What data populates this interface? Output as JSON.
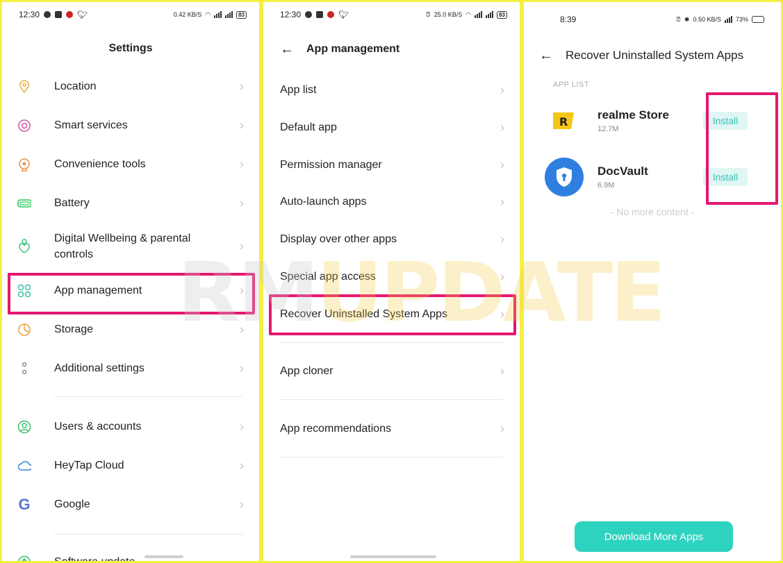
{
  "panel1": {
    "status": {
      "time": "12:30",
      "net": "0.42 KB/S",
      "battery": "83"
    },
    "title": "Settings",
    "items": [
      {
        "label": "Location",
        "icon": "location-pin-icon",
        "color": "#e9b44c"
      },
      {
        "label": "Smart services",
        "icon": "smart-services-icon",
        "color": "#d257a5"
      },
      {
        "label": "Convenience tools",
        "icon": "convenience-tools-icon",
        "color": "#e9964c"
      },
      {
        "label": "Battery",
        "icon": "battery-icon",
        "color": "#2ec45f"
      },
      {
        "label": "Digital Wellbeing & parental controls",
        "icon": "wellbeing-heart-icon",
        "color": "#3bbf7a"
      },
      {
        "label": "App management",
        "icon": "app-management-icon",
        "color": "#36c0a8"
      },
      {
        "label": "Storage",
        "icon": "storage-pie-icon",
        "color": "#f0a23b"
      },
      {
        "label": "Additional settings",
        "icon": "additional-settings-icon",
        "color": "#888888"
      },
      {
        "label": "Users & accounts",
        "icon": "users-accounts-icon",
        "color": "#3bbf6c"
      },
      {
        "label": "HeyTap Cloud",
        "icon": "cloud-icon",
        "color": "#3b82d8"
      },
      {
        "label": "Google",
        "icon": "google-g-icon",
        "color": "#5b73c9"
      },
      {
        "label": "Software update",
        "icon": "software-update-icon",
        "color": "#3bbf6c"
      }
    ]
  },
  "panel2": {
    "status": {
      "time": "12:30",
      "net": "25.0 KB/S",
      "battery": "83"
    },
    "title": "App management",
    "items": [
      {
        "label": "App list"
      },
      {
        "label": "Default app"
      },
      {
        "label": "Permission manager"
      },
      {
        "label": "Auto-launch apps"
      },
      {
        "label": "Display over other apps"
      },
      {
        "label": "Special app access"
      },
      {
        "label": "Recover Uninstalled System Apps"
      },
      {
        "label": "App cloner"
      },
      {
        "label": "App recommendations"
      }
    ]
  },
  "panel3": {
    "status": {
      "time": "8:39",
      "net": "0.50 KB/S",
      "battery": "73%"
    },
    "title": "Recover Uninstalled System Apps",
    "section_label": "APP LIST",
    "apps": [
      {
        "name": "realme Store",
        "size": "12.7M",
        "action": "Install",
        "icon": "realme-store-icon"
      },
      {
        "name": "DocVault",
        "size": "6.9M",
        "action": "Install",
        "icon": "docvault-shield-icon"
      }
    ],
    "no_more": "- No more content -",
    "download_button": "Download More Apps"
  },
  "watermark": "RMUPDATE",
  "colors": {
    "accent": "#2ed3c0",
    "highlight": "#e5166f",
    "frame": "#f4f042"
  }
}
